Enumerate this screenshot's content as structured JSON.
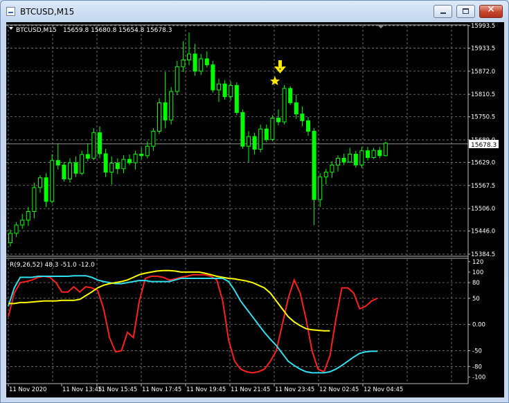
{
  "window": {
    "title": "BTCUSD,M15",
    "minimize_glyph": "",
    "maximize_glyph": "",
    "close_glyph": "✕"
  },
  "chart": {
    "label": "BTCUSD,M15",
    "ohlc_text": "15659.8 15680.8 15654.8 15678.3",
    "current_price_label": "15678.3",
    "indicator_label": "R(9,26,52) 48.3 -51.0 -12.0",
    "colors": {
      "background": "#000000",
      "grid": "#9a9a9a",
      "candle_up": "#00ff00",
      "candle_down": "#000000",
      "line_red": "#ff2020",
      "line_cyan": "#30e0f0",
      "line_yellow": "#ffff00",
      "arrow": "#ffee00",
      "star": "#ffee00",
      "text": "#ffffff"
    },
    "icons": {
      "arrow": "down-arrow-icon",
      "star": "star-icon"
    }
  },
  "chart_data": [
    {
      "type": "candlestick",
      "title": "BTCUSD,M15",
      "symbol": "BTCUSD",
      "timeframe": "M15",
      "ylim": [
        15384.5,
        15993.5
      ],
      "y_ticks": [
        "15993.5",
        "15933.5",
        "15872.0",
        "15810.5",
        "15750.5",
        "15689.0",
        "15629.0",
        "15567.5",
        "15506.0",
        "15446.0",
        "15384.5"
      ],
      "last_price": 15678.3,
      "candles": [
        [
          15415,
          15450,
          15405,
          15440
        ],
        [
          15440,
          15470,
          15430,
          15462
        ],
        [
          15462,
          15492,
          15452,
          15475
        ],
        [
          15475,
          15510,
          15460,
          15498
        ],
        [
          15498,
          15575,
          15480,
          15562
        ],
        [
          15562,
          15595,
          15548,
          15588
        ],
        [
          15588,
          15600,
          15510,
          15525
        ],
        [
          15525,
          15650,
          15520,
          15634
        ],
        [
          15634,
          15680,
          15610,
          15622
        ],
        [
          15622,
          15630,
          15578,
          15585
        ],
        [
          15585,
          15640,
          15575,
          15628
        ],
        [
          15628,
          15645,
          15590,
          15600
        ],
        [
          15600,
          15660,
          15595,
          15650
        ],
        [
          15650,
          15680,
          15632,
          15640
        ],
        [
          15640,
          15720,
          15635,
          15708
        ],
        [
          15708,
          15725,
          15640,
          15652
        ],
        [
          15652,
          15665,
          15590,
          15603
        ],
        [
          15603,
          15645,
          15570,
          15627
        ],
        [
          15627,
          15640,
          15598,
          15612
        ],
        [
          15612,
          15648,
          15600,
          15637
        ],
        [
          15637,
          15650,
          15622,
          15628
        ],
        [
          15628,
          15660,
          15610,
          15651
        ],
        [
          15651,
          15668,
          15638,
          15647
        ],
        [
          15647,
          15685,
          15640,
          15672
        ],
        [
          15672,
          15720,
          15660,
          15712
        ],
        [
          15712,
          15800,
          15705,
          15788
        ],
        [
          15788,
          15870,
          15720,
          15742
        ],
        [
          15742,
          15830,
          15730,
          15818
        ],
        [
          15818,
          15900,
          15808,
          15884
        ],
        [
          15884,
          15952,
          15870,
          15902
        ],
        [
          15902,
          15975,
          15888,
          15918
        ],
        [
          15918,
          15945,
          15860,
          15872
        ],
        [
          15872,
          15918,
          15862,
          15905
        ],
        [
          15905,
          15925,
          15882,
          15889
        ],
        [
          15889,
          15900,
          15815,
          15822
        ],
        [
          15822,
          15852,
          15790,
          15838
        ],
        [
          15838,
          15848,
          15796,
          15804
        ],
        [
          15804,
          15845,
          15794,
          15834
        ],
        [
          15834,
          15842,
          15755,
          15762
        ],
        [
          15762,
          15770,
          15665,
          15672
        ],
        [
          15672,
          15712,
          15630,
          15698
        ],
        [
          15698,
          15708,
          15650,
          15664
        ],
        [
          15664,
          15730,
          15656,
          15718
        ],
        [
          15718,
          15730,
          15683,
          15690
        ],
        [
          15690,
          15755,
          15685,
          15747
        ],
        [
          15747,
          15770,
          15728,
          15737
        ],
        [
          15737,
          15835,
          15730,
          15826
        ],
        [
          15826,
          15832,
          15782,
          15788
        ],
        [
          15788,
          15810,
          15745,
          15758
        ],
        [
          15758,
          15778,
          15725,
          15740
        ],
        [
          15740,
          15750,
          15700,
          15712
        ],
        [
          15712,
          15720,
          15462,
          15530
        ],
        [
          15530,
          15600,
          15510,
          15590
        ],
        [
          15590,
          15612,
          15570,
          15603
        ],
        [
          15603,
          15632,
          15588,
          15622
        ],
        [
          15622,
          15648,
          15605,
          15640
        ],
        [
          15640,
          15652,
          15622,
          15630
        ],
        [
          15630,
          15668,
          15628,
          15651
        ],
        [
          15651,
          15660,
          15615,
          15622
        ],
        [
          15622,
          15670,
          15614,
          15660
        ],
        [
          15660,
          15670,
          15634,
          15642
        ],
        [
          15642,
          15668,
          15638,
          15661
        ],
        [
          15661,
          15670,
          15640,
          15647
        ],
        [
          15647,
          15684,
          15645,
          15680
        ]
      ]
    },
    {
      "type": "line",
      "title": "R(9,26,52) 48.3 -51.0 -12.0",
      "ylim": [
        -110,
        125
      ],
      "y_ticks": [
        "120",
        "100",
        "80",
        "50",
        "0.00",
        "-50",
        "-80",
        "-100"
      ],
      "series": [
        {
          "values": [
            15,
            60,
            80,
            82,
            85,
            90,
            92,
            90,
            80,
            62,
            62,
            72,
            62,
            72,
            70,
            65,
            30,
            -25,
            -52,
            -50,
            -15,
            -25,
            45,
            88,
            92,
            92,
            90,
            85,
            87,
            90,
            92,
            95,
            95,
            95,
            92,
            85,
            45,
            -30,
            -70,
            -85,
            -90,
            -92,
            -90,
            -85,
            -70,
            -50,
            0,
            50,
            85,
            60,
            10,
            -50,
            -85,
            -90,
            -60,
            10,
            70,
            70,
            60,
            30,
            35,
            45,
            50
          ]
        },
        {
          "values": [
            35,
            70,
            90,
            90,
            90,
            92,
            92,
            92,
            92,
            92,
            92,
            93,
            93,
            93,
            90,
            85,
            82,
            80,
            78,
            78,
            80,
            82,
            84,
            84,
            82,
            82,
            82,
            82,
            85,
            88,
            88,
            88,
            88,
            88,
            88,
            88,
            88,
            82,
            65,
            45,
            30,
            15,
            0,
            -15,
            -28,
            -40,
            -55,
            -70,
            -78,
            -85,
            -90,
            -92,
            -92,
            -92,
            -90,
            -85,
            -78,
            -70,
            -62,
            -55,
            -52,
            -51,
            -51
          ]
        },
        {
          "values": [
            40,
            40,
            42,
            42,
            43,
            44,
            45,
            45,
            45,
            46,
            46,
            46,
            48,
            55,
            62,
            70,
            75,
            78,
            80,
            82,
            85,
            90,
            95,
            98,
            100,
            102,
            103,
            103,
            102,
            100,
            100,
            100,
            100,
            98,
            95,
            92,
            90,
            88,
            87,
            85,
            83,
            80,
            75,
            70,
            60,
            45,
            30,
            15,
            5,
            -2,
            -8,
            -10,
            -11,
            -12,
            -12
          ]
        }
      ]
    }
  ],
  "x_axis": {
    "labels": [
      "11 Nov 2020",
      "11 Nov 13:45",
      "11 Nov 15:45",
      "11 Nov 17:45",
      "11 Nov 19:45",
      "11 Nov 21:45",
      "11 Nov 23:45",
      "12 Nov 02:45",
      "12 Nov 04:45"
    ]
  }
}
